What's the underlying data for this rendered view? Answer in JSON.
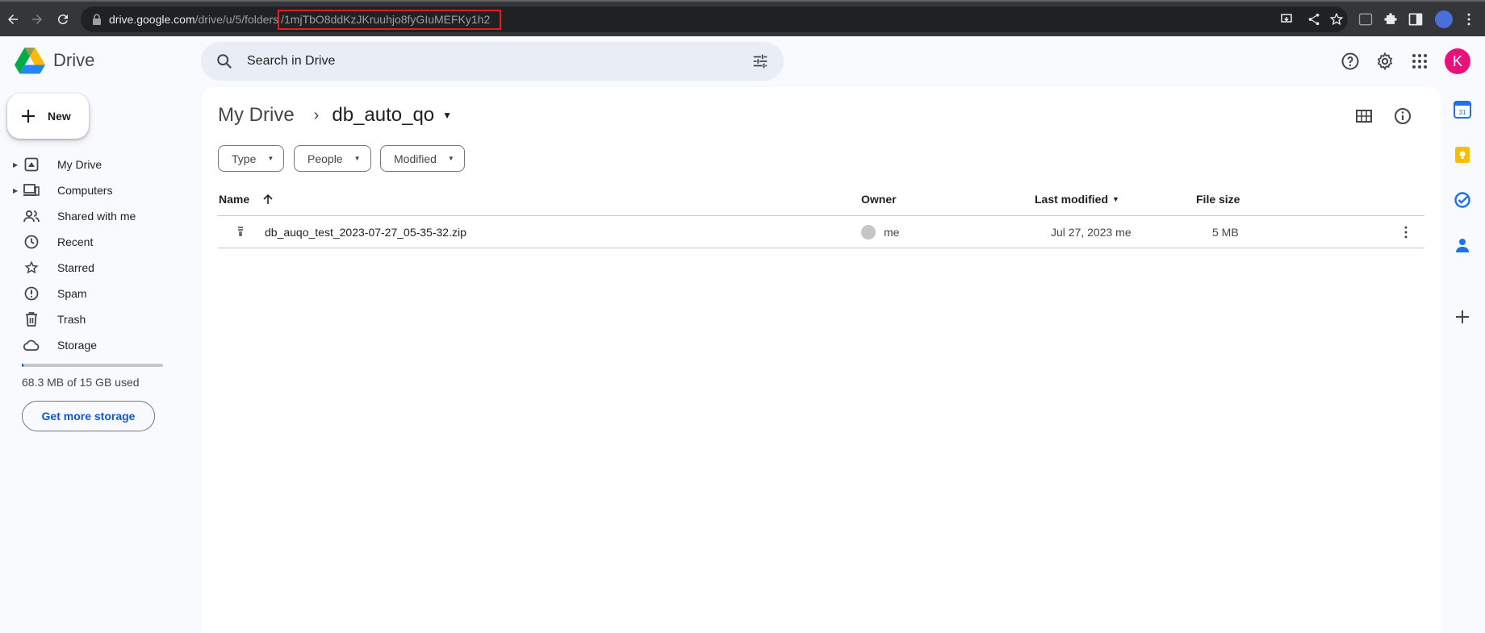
{
  "browser": {
    "url_host": "drive.google.com",
    "url_path": "/drive/u/5/folders",
    "url_folder_id": "/1mjTbO8ddKzJKruuhjo8fyGIuMEFKy1h2"
  },
  "app": {
    "name": "Drive"
  },
  "search": {
    "placeholder": "Search in Drive"
  },
  "account": {
    "initial": "K",
    "color": "#e8127a"
  },
  "sidebar": {
    "new_label": "New",
    "items": [
      {
        "label": "My Drive",
        "icon": "my-drive-icon",
        "expandable": true
      },
      {
        "label": "Computers",
        "icon": "computers-icon",
        "expandable": true
      },
      {
        "label": "Shared with me",
        "icon": "shared-icon",
        "expandable": false
      },
      {
        "label": "Recent",
        "icon": "clock-icon",
        "expandable": false
      },
      {
        "label": "Starred",
        "icon": "star-icon",
        "expandable": false
      },
      {
        "label": "Spam",
        "icon": "spam-icon",
        "expandable": false
      },
      {
        "label": "Trash",
        "icon": "trash-icon",
        "expandable": false
      },
      {
        "label": "Storage",
        "icon": "cloud-icon",
        "expandable": false
      }
    ],
    "storage_text": "68.3 MB of 15 GB used",
    "storage_used_fraction": 0.0045,
    "get_storage_label": "Get more storage"
  },
  "breadcrumb": {
    "root": "My Drive",
    "current": "db_auto_qo"
  },
  "filters": [
    "Type",
    "People",
    "Modified"
  ],
  "table": {
    "headers": {
      "name": "Name",
      "owner": "Owner",
      "modified": "Last modified",
      "size": "File size"
    },
    "rows": [
      {
        "name": "db_auqo_test_2023-07-27_05-35-32.zip",
        "owner": "me",
        "modified": "Jul 27, 2023 me",
        "size": "5 MB"
      }
    ]
  },
  "colors": {
    "accent": "#0b57d0",
    "highlight_box": "#e02020"
  }
}
